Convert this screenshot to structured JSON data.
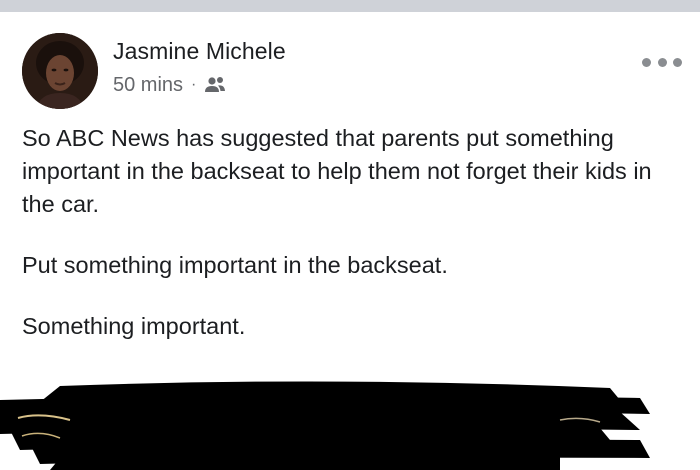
{
  "post": {
    "author_name": "Jasmine Michele",
    "timestamp": "50 mins",
    "separator": "·",
    "audience_icon": "friends-icon",
    "menu_icon": "more-options-icon",
    "paragraphs": [
      "So ABC News has suggested that parents put something important in the backseat to help them not forget their kids in the car.",
      "Put something important in the backseat.",
      "Something important."
    ]
  },
  "colors": {
    "text_primary": "#1c1e21",
    "text_secondary": "#65676b",
    "top_strip": "#cfd2d8",
    "redaction": "#000000"
  }
}
